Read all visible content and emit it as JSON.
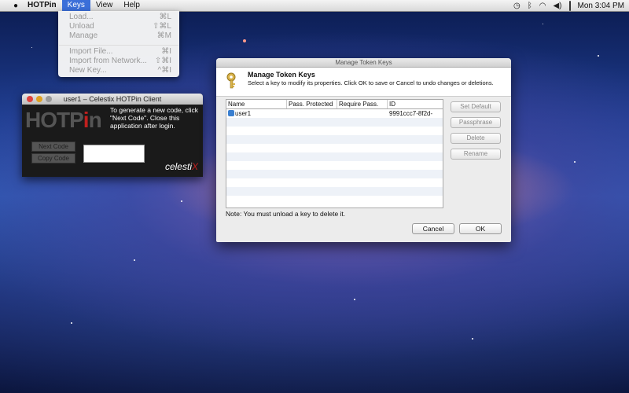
{
  "menubar": {
    "app_name": "HOTPin",
    "menus": [
      "Keys",
      "View",
      "Help"
    ],
    "status_icons": [
      "time-machine-icon",
      "bluetooth-icon",
      "wifi-icon",
      "volume-icon",
      "battery-icon"
    ],
    "clock": "Mon 3:04 PM"
  },
  "keys_menu": {
    "items": [
      {
        "label": "Load...",
        "shortcut": "⌘L",
        "enabled": false
      },
      {
        "label": "Unload",
        "shortcut": "⇧⌘L",
        "enabled": false
      },
      {
        "label": "Manage",
        "shortcut": "⌘M",
        "enabled": false
      },
      {
        "label": "Import File...",
        "shortcut": "⌘I",
        "enabled": false
      },
      {
        "label": "Import from Network...",
        "shortcut": "⇧⌘I",
        "enabled": false
      },
      {
        "label": "New Key...",
        "shortcut": "^⌘I",
        "enabled": false
      }
    ]
  },
  "client_window": {
    "title": "user1 – Celestix HOTPin Client",
    "logo_text": "HOTP",
    "logo_accent": "i",
    "logo_end": "n",
    "message": "To generate a new code, click \"Next Code\". Close this application after login.",
    "buttons": [
      "Next Code",
      "Copy Code"
    ],
    "brand_text": "celesti",
    "brand_accent": "X"
  },
  "dialog": {
    "title": "Manage Token Keys",
    "heading": "Manage Token Keys",
    "subheading": "Select a key to modify its properties. Click OK to save or Cancel to undo changes or deletions.",
    "columns": [
      "Name",
      "Pass. Protected",
      "Require Pass.",
      "ID"
    ],
    "rows": [
      {
        "name": "user1",
        "pass_protected": "",
        "require_pass": "",
        "id": "9991ccc7-8f2d-"
      }
    ],
    "side_buttons": [
      "Set Default",
      "Passphrase",
      "Delete",
      "Rename"
    ],
    "note": "Note: You must unload a key to delete it.",
    "cancel_label": "Cancel",
    "ok_label": "OK"
  },
  "colors": {
    "menu_highlight": "#3b6fd9",
    "logo_accent": "#c0201e"
  }
}
